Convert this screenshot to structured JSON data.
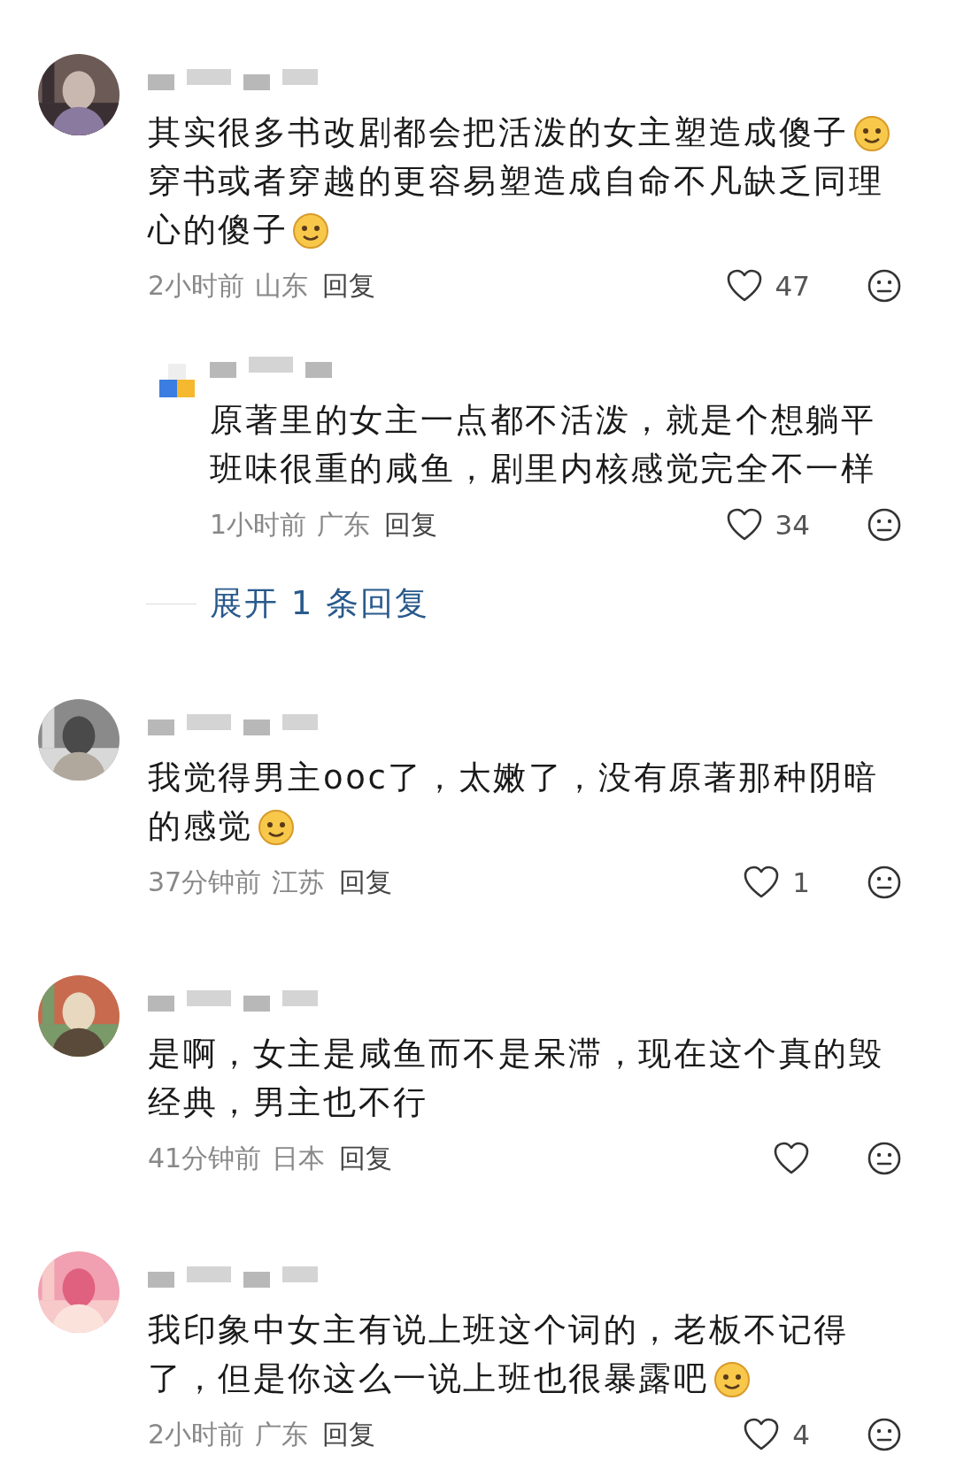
{
  "comments": [
    {
      "avatar": {
        "kind": "picture"
      },
      "lines": [
        {
          "text": "其实很多书改剧都会把活泼的女主塑造成傻子",
          "emoji": true
        },
        {
          "text": "穿书或者穿越的更容易塑造成自命不凡缺乏同理",
          "emoji": false
        },
        {
          "text": "心的傻子",
          "emoji": true
        }
      ],
      "time": "2小时前",
      "location": "山东",
      "reply_label": "回复",
      "likes": "47",
      "replies": [
        {
          "avatar": {
            "kind": "picture"
          },
          "lines": [
            {
              "text": "原著里的女主一点都不活泼，就是个想躺平",
              "emoji": false
            },
            {
              "text": "班味很重的咸鱼，剧里内核感觉完全不一样",
              "emoji": false
            }
          ],
          "time": "1小时前",
          "location": "广东",
          "reply_label": "回复",
          "likes": "34"
        }
      ],
      "expand_label": "展开 1 条回复"
    },
    {
      "avatar": {
        "kind": "picture"
      },
      "lines": [
        {
          "text": "我觉得男主ooc了，太嫩了，没有原著那种阴暗",
          "emoji": false
        },
        {
          "text": "的感觉",
          "emoji": true
        }
      ],
      "time": "37分钟前",
      "location": "江苏",
      "reply_label": "回复",
      "likes": "1"
    },
    {
      "avatar": {
        "kind": "picture"
      },
      "lines": [
        {
          "text": "是啊，女主是咸鱼而不是呆滞，现在这个真的毁",
          "emoji": false
        },
        {
          "text": "经典，男主也不行",
          "emoji": false
        }
      ],
      "time": "41分钟前",
      "location": "日本",
      "reply_label": "回复"
    },
    {
      "avatar": {
        "kind": "picture"
      },
      "lines": [
        {
          "text": "我印象中女主有说上班这个词的，老板不记得",
          "emoji": false
        },
        {
          "text": "了，但是你这么一说上班也很暴露吧",
          "emoji": true
        }
      ],
      "time": "2小时前",
      "location": "广东",
      "reply_label": "回复",
      "likes": "4"
    }
  ]
}
